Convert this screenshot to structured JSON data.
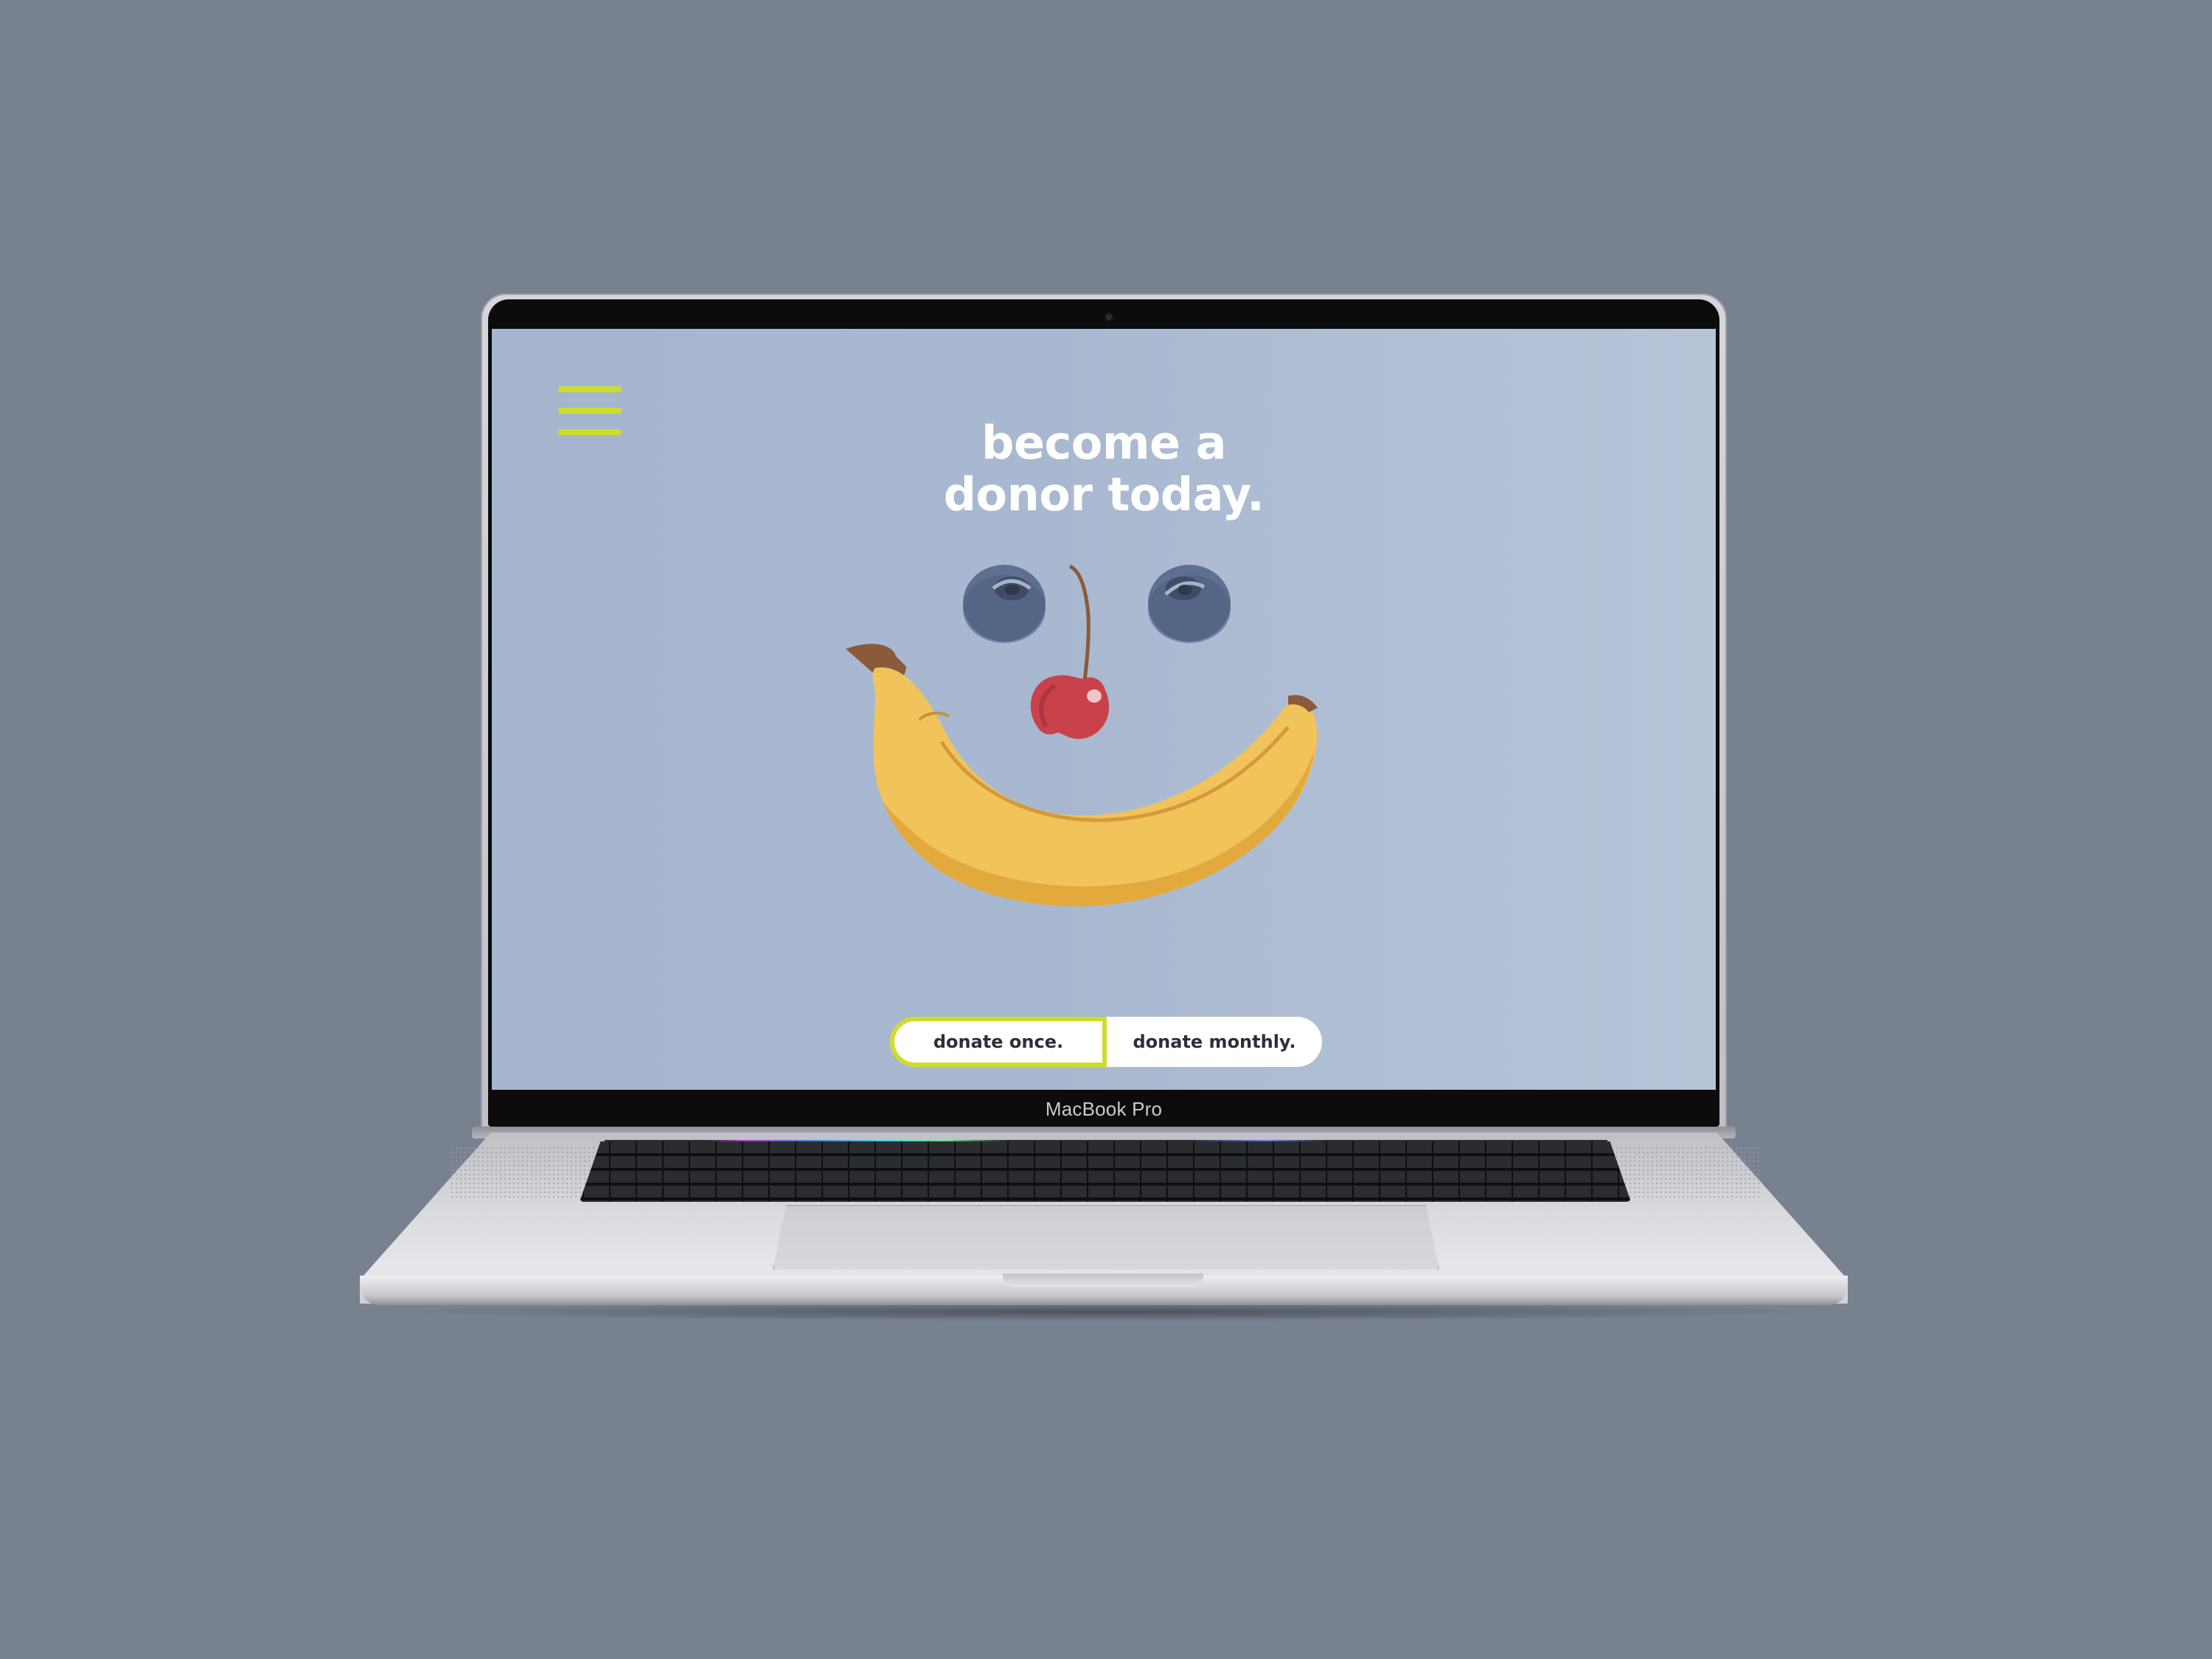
{
  "device": {
    "model_label": "MacBook Pro"
  },
  "page": {
    "headline": [
      "become a",
      "donor today."
    ],
    "menu": {
      "icon": "hamburger-menu-icon",
      "accent_color": "#cfdd2a"
    },
    "illustration": {
      "description_icons": [
        "blueberry-icon",
        "cherry-icon",
        "banana-icon"
      ]
    },
    "donation_toggle": {
      "options": [
        {
          "label": "donate once.",
          "selected": true
        },
        {
          "label": "donate monthly.",
          "selected": false
        }
      ]
    },
    "colors": {
      "background": "#a8b8d0",
      "headline": "#ffffff",
      "accent": "#cfdd2a",
      "button_bg": "#ffffff",
      "button_text": "#2b2f3a"
    }
  }
}
